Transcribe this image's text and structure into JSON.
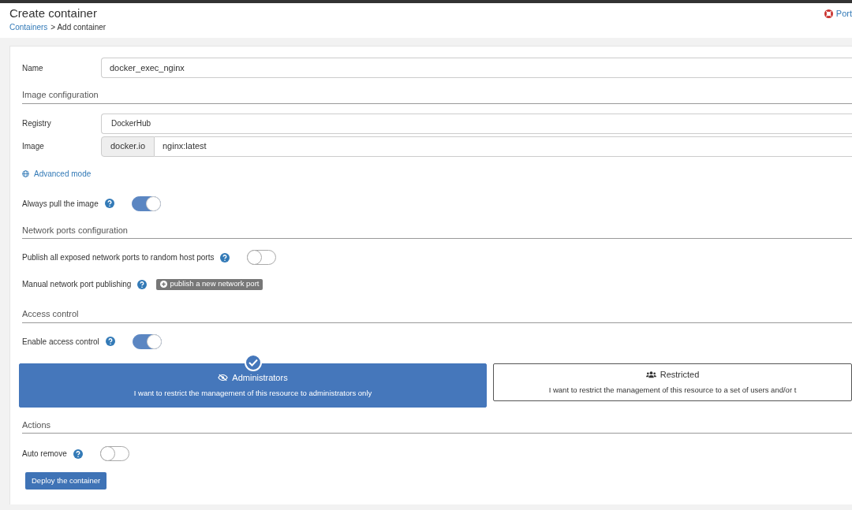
{
  "header": {
    "title": "Create container",
    "breadcrumb_link": "Containers",
    "breadcrumb_rest": "> Add container",
    "top_right_link": "Port"
  },
  "name_field": {
    "label": "Name",
    "value": "docker_exec_nginx"
  },
  "image_section": {
    "title": "Image configuration",
    "registry_label": "Registry",
    "registry_value": "DockerHub",
    "image_label": "Image",
    "image_prefix": "docker.io",
    "image_value": "nginx:latest",
    "advanced_link": "Advanced mode"
  },
  "always_pull": {
    "label": "Always pull the image",
    "on": true
  },
  "network_section": {
    "title": "Network ports configuration",
    "publish_all": {
      "label": "Publish all exposed network ports to random host ports",
      "on": false
    },
    "manual_label": "Manual network port publishing",
    "manual_button": "publish a new network port"
  },
  "access_section": {
    "title": "Access control",
    "enable": {
      "label": "Enable access control",
      "on": true
    },
    "options": [
      {
        "kind": "admin",
        "title": "Administrators",
        "description": "I want to restrict the management of this resource to administrators only",
        "selected": true
      },
      {
        "kind": "restricted",
        "title": "Restricted",
        "description": "I want to restrict the management of this resource to a set of users and/or t",
        "selected": false
      }
    ]
  },
  "actions_section": {
    "title": "Actions",
    "auto_remove": {
      "label": "Auto remove",
      "on": false
    },
    "deploy_button": "Deploy the container"
  }
}
